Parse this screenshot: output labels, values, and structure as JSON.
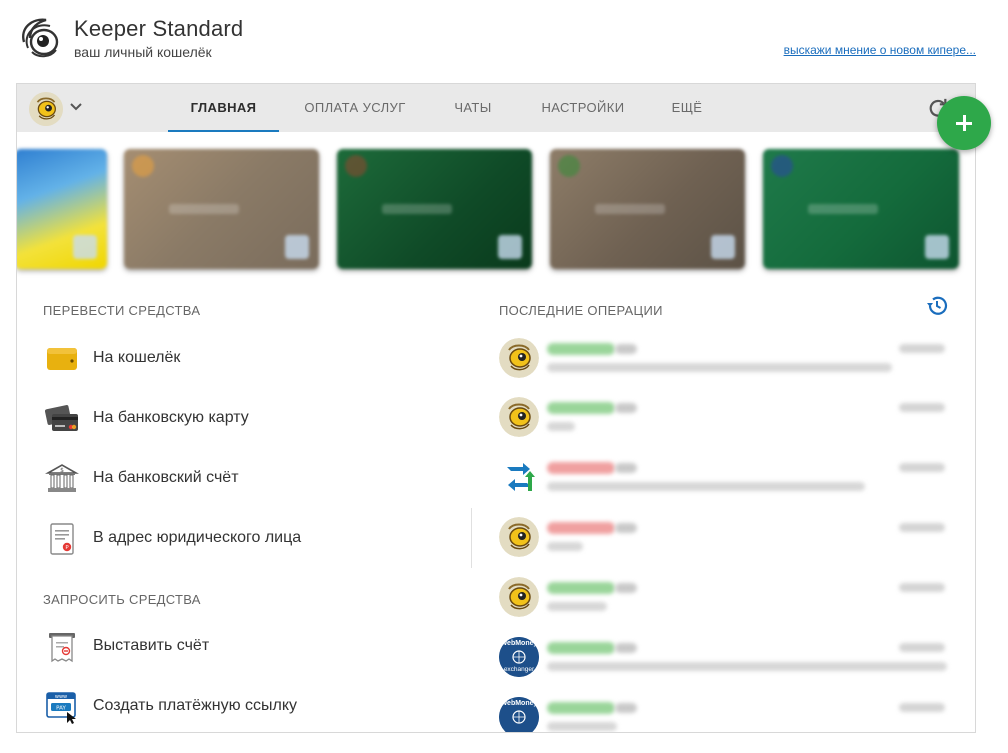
{
  "header": {
    "title": "Keeper Standard",
    "subtitle": "ваш личный кошелёк",
    "feedback_link": "выскажи мнение о новом кипере..."
  },
  "nav": {
    "tabs": [
      {
        "label": "ГЛАВНАЯ",
        "active": true
      },
      {
        "label": "ОПЛАТА УСЛУГ",
        "active": false
      },
      {
        "label": "ЧАТЫ",
        "active": false
      },
      {
        "label": "НАСТРОЙКИ",
        "active": false
      },
      {
        "label": "ЕЩЁ",
        "active": false
      }
    ],
    "accent_color": "#1a7abf"
  },
  "cards": [
    {
      "style": "yellow-blue"
    },
    {
      "style": "brown"
    },
    {
      "style": "green"
    },
    {
      "style": "brown"
    },
    {
      "style": "green"
    }
  ],
  "transfer": {
    "title": "ПЕРЕВЕСТИ СРЕДСТВА",
    "items": [
      {
        "label": "На кошелёк",
        "icon": "wallet-icon"
      },
      {
        "label": "На банковскую карту",
        "icon": "bank-card-icon"
      },
      {
        "label": "На банковский счёт",
        "icon": "bank-building-icon"
      },
      {
        "label": "В адрес юридического лица",
        "icon": "invoice-document-icon"
      }
    ]
  },
  "request": {
    "title": "ЗАПРОСИТЬ СРЕДСТВА",
    "items": [
      {
        "label": "Выставить счёт",
        "icon": "bill-icon"
      },
      {
        "label": "Создать платёжную ссылку",
        "icon": "payment-link-icon"
      }
    ]
  },
  "operations": {
    "title": "ПОСЛЕДНИЕ ОПЕРАЦИИ",
    "items": [
      {
        "avatar": "owl-avatar",
        "sign": "positive"
      },
      {
        "avatar": "owl-avatar",
        "sign": "positive"
      },
      {
        "avatar": "exchange-arrows-icon",
        "sign": "negative"
      },
      {
        "avatar": "owl-avatar",
        "sign": "negative"
      },
      {
        "avatar": "owl-avatar",
        "sign": "positive"
      },
      {
        "avatar": "webmoney-exchanger-icon",
        "sign": "positive",
        "badge_top": "WebMoney",
        "badge_bottom": "exchanger"
      },
      {
        "avatar": "webmoney-exchanger-icon",
        "sign": "positive",
        "badge_top": "WebMoney",
        "badge_bottom": ""
      }
    ]
  },
  "colors": {
    "fab_green": "#2ea84a",
    "link_blue": "#1a6dbd",
    "navbar_bg": "#e9e9e9"
  }
}
